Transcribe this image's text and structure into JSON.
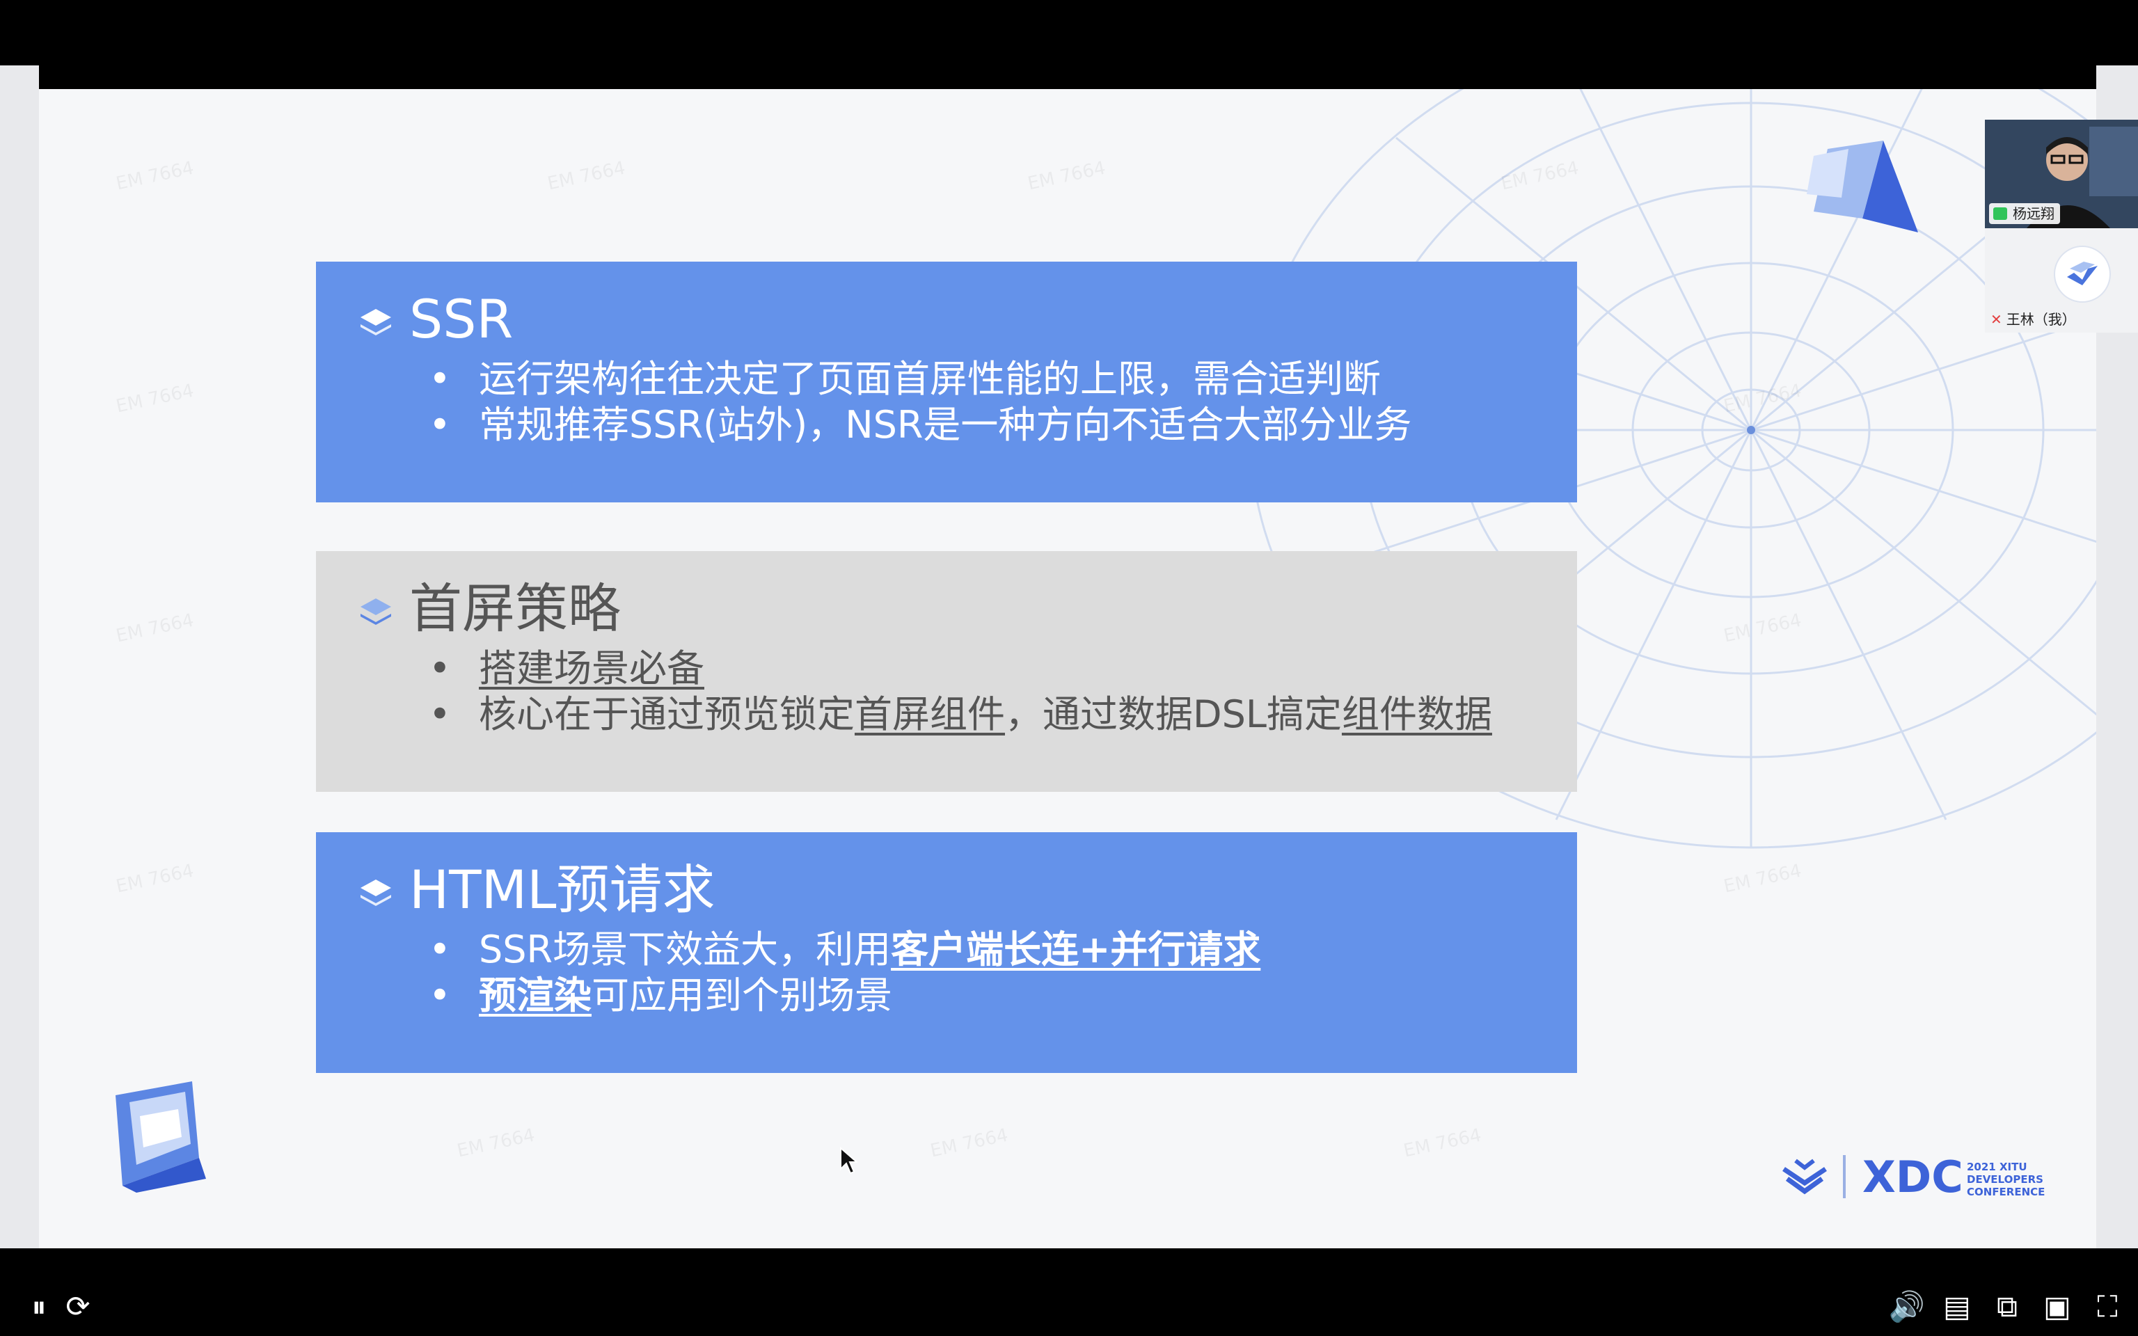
{
  "slide": {
    "cards": [
      {
        "title": "SSR",
        "bullets": [
          {
            "segments": [
              {
                "text": "运行架构往往决定了页面首屏性能的上限，需合适判断"
              }
            ]
          },
          {
            "segments": [
              {
                "text": "常规推荐SSR(站外)，NSR是一种方向不适合大部分业务"
              }
            ]
          }
        ]
      },
      {
        "title": "首屏策略",
        "bullets": [
          {
            "segments": [
              {
                "text": "搭建场景必备"
              }
            ]
          },
          {
            "segments": [
              {
                "text": "核心在于通过预览锁定"
              },
              {
                "text": "首屏组件"
              },
              {
                "text": "，通过数据DSL搞定"
              },
              {
                "text": "组件数据"
              }
            ]
          }
        ]
      },
      {
        "title": "HTML预请求",
        "bullets": [
          {
            "segments": [
              {
                "text": "SSR场景下效益大，利用"
              },
              {
                "text": "客户端长连+并行请求"
              }
            ]
          },
          {
            "segments": [
              {
                "text": "预渲染"
              },
              {
                "text": "可应用到个别场景"
              }
            ]
          }
        ]
      }
    ],
    "bullet_char": "•",
    "watermark": "EM 7664",
    "logo": {
      "name": "XDC",
      "tagline_1": "2021 XITU",
      "tagline_2": "DEVELOPERS",
      "tagline_3": "CONFERENCE"
    }
  },
  "participants": [
    {
      "name": "杨远翔",
      "mic": "on"
    },
    {
      "name": "王林（我）",
      "mic": "muted"
    }
  ],
  "controls": [
    {
      "name": "pause-icon",
      "glyph": "⏸"
    },
    {
      "name": "replay-icon",
      "glyph": "⟳"
    },
    {
      "name": "volume-icon",
      "glyph": "🔊"
    },
    {
      "name": "subtitles-icon",
      "glyph": "▤"
    },
    {
      "name": "picture-in-picture-icon",
      "glyph": "⧉"
    },
    {
      "name": "theater-mode-icon",
      "glyph": "▣"
    },
    {
      "name": "fullscreen-icon",
      "glyph": "⛶"
    }
  ],
  "colors": {
    "card_blue": "#6492ea",
    "card_gray": "#dcdcdc",
    "slide_bg": "#f6f7f9",
    "player_bg": "#000000"
  }
}
